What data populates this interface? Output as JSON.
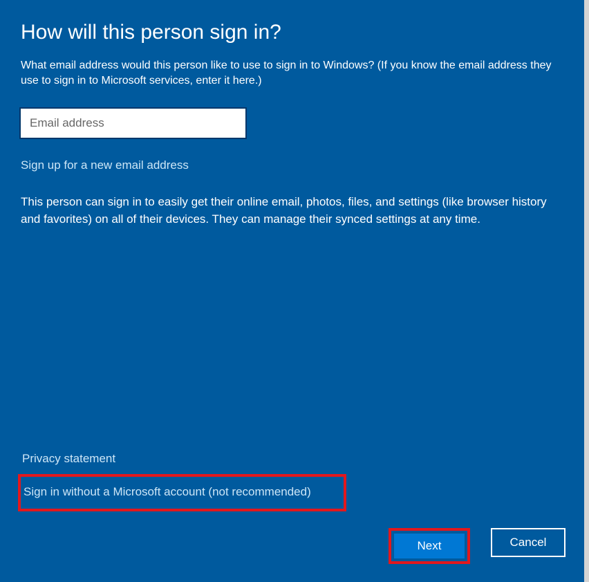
{
  "title": "How will this person sign in?",
  "subtitle": "What email address would this person like to use to sign in to Windows? (If you know the email address they use to sign in to Microsoft services, enter it here.)",
  "email": {
    "placeholder": "Email address",
    "value": ""
  },
  "signup_link": "Sign up for a new email address",
  "description": "This person can sign in to easily get their online email, photos, files, and settings (like browser history and favorites) on all of their devices. They can manage their synced settings at any time.",
  "privacy_link": "Privacy statement",
  "no_account_link": "Sign in without a Microsoft account (not recommended)",
  "buttons": {
    "next": "Next",
    "cancel": "Cancel"
  }
}
